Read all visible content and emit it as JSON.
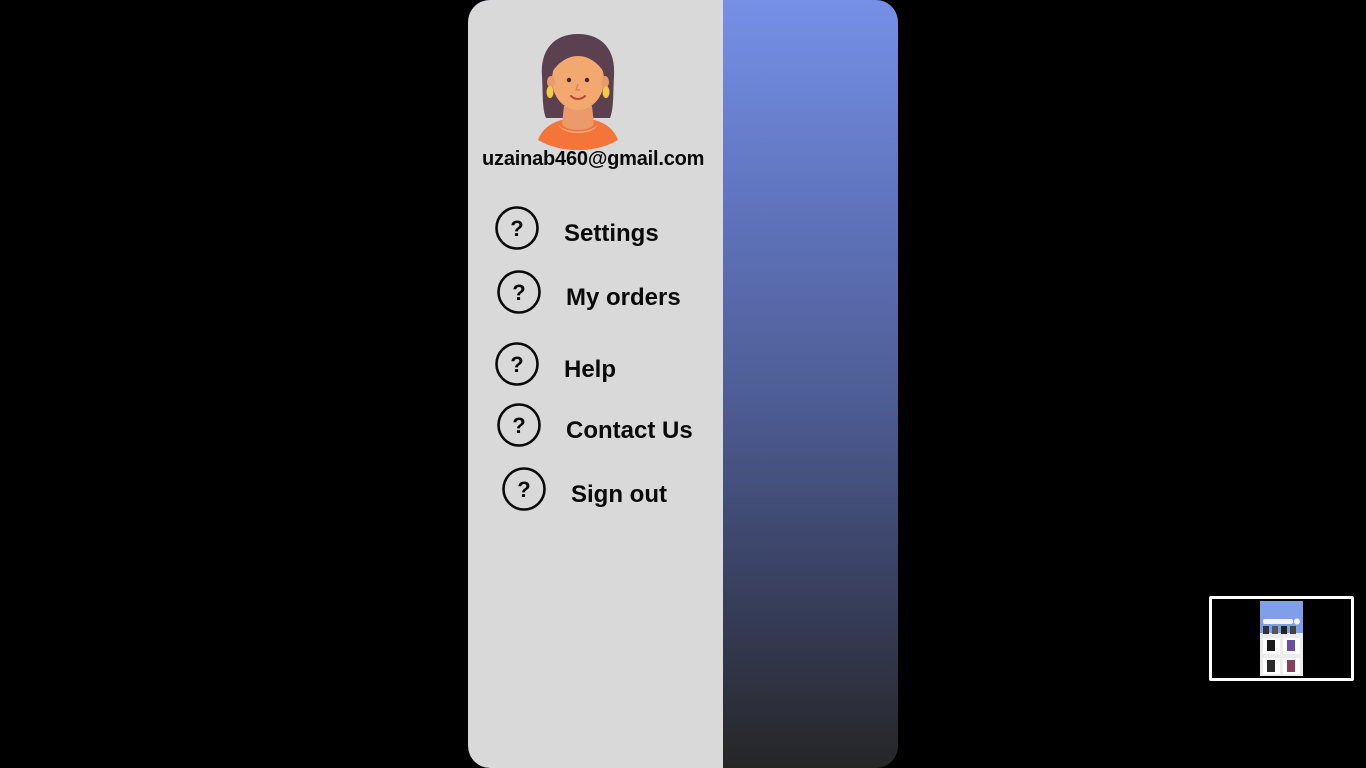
{
  "profile": {
    "email": "uzainab460@gmail.com",
    "avatar_icon": "woman-avatar-icon"
  },
  "menu": {
    "items": [
      {
        "label": "Settings",
        "icon": "question-circle-icon"
      },
      {
        "label": "My orders",
        "icon": "question-circle-icon"
      },
      {
        "label": "Help",
        "icon": "question-circle-icon"
      },
      {
        "label": "Contact Us",
        "icon": "question-circle-icon"
      },
      {
        "label": "Sign out",
        "icon": "question-circle-icon"
      }
    ]
  },
  "colors": {
    "page_background": "#000000",
    "drawer_background": "#d9d9d9",
    "gradient_top": "#7590e6",
    "gradient_bottom": "#262626",
    "text": "#0a0a0a"
  }
}
